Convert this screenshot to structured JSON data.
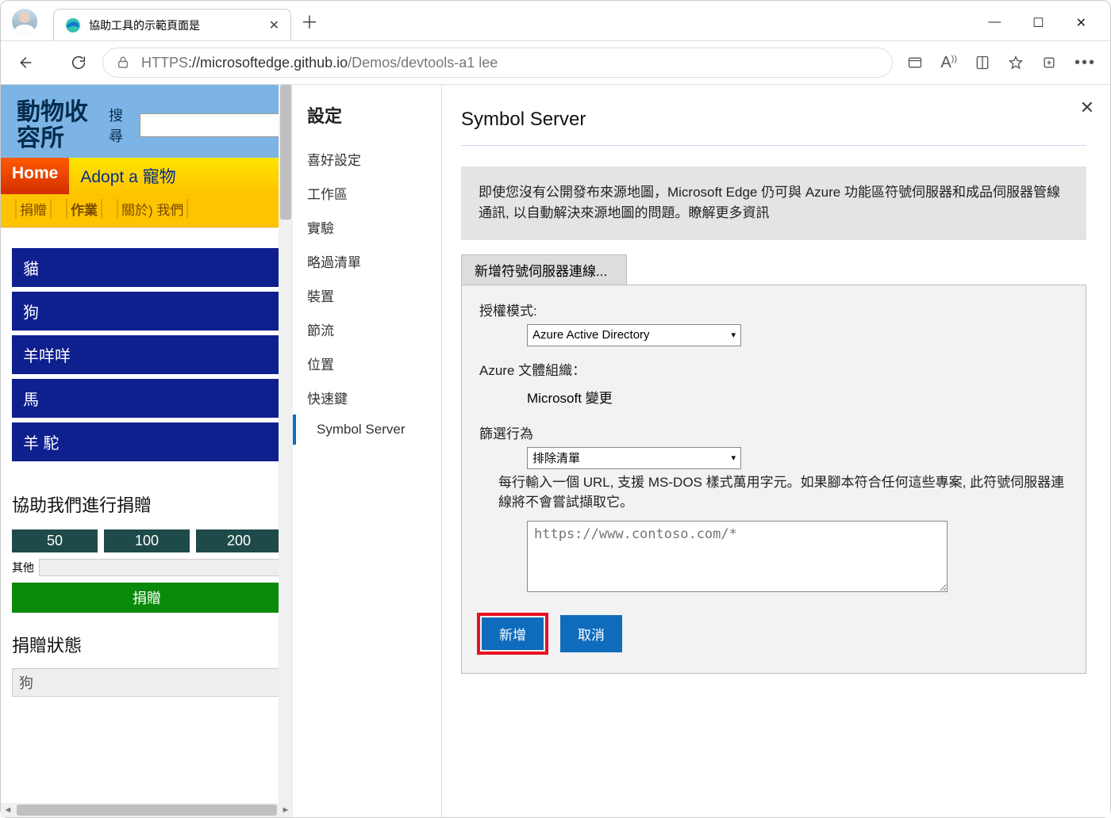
{
  "window": {
    "tab_title": "協助工具的示範頁面是",
    "url_scheme": "HTTPS",
    "url_host": "://microsoftedge.github.io",
    "url_path": "/Demos/devtools-a1 lee"
  },
  "demo_page": {
    "site_title": "動物收容所",
    "search_label": "搜尋",
    "nav_primary": {
      "home": "Home",
      "adopt": "Adopt a 寵物"
    },
    "nav_secondary": [
      "捐贈",
      "作業",
      "關於) 我們"
    ],
    "animals": [
      "貓",
      "狗",
      "羊咩咩",
      "馬",
      "羊 駝"
    ],
    "donate": {
      "heading": "協助我們進行捐贈",
      "amounts": [
        "50",
        "100",
        "200"
      ],
      "other_label": "其他",
      "button": "捐贈"
    },
    "status": {
      "heading": "捐贈狀態",
      "value": "狗"
    }
  },
  "settings": {
    "title": "設定",
    "items": [
      "喜好設定",
      "工作區",
      "實驗",
      "略過清單",
      "裝置",
      "節流",
      "位置",
      "快速鍵",
      "Symbol Server"
    ],
    "selected_index": 8
  },
  "panel": {
    "heading": "Symbol Server",
    "info": "即使您沒有公開發布來源地圖，Microsoft Edge 仍可與 Azure 功能區符號伺服器和成品伺服器管線通訊, 以自動解決來源地圖的問題。瞭解更多資訊",
    "tab_label": "新增符號伺服器連線...",
    "auth_mode_label": "授權模式:",
    "auth_mode_value": "Azure Active Directory",
    "org_label": "Azure 文體組織：",
    "org_value": "Microsoft 變更",
    "filter_label": "篩選行為",
    "filter_value": "排除清單",
    "filter_help": "每行輸入一個 URL, 支援 MS-DOS 樣式萬用字元。如果腳本符合任何這些專案, 此符號伺服器連線將不會嘗試擷取它。",
    "filter_placeholder": "https://www.contoso.com/*",
    "add_button": "新增",
    "cancel_button": "取消"
  }
}
